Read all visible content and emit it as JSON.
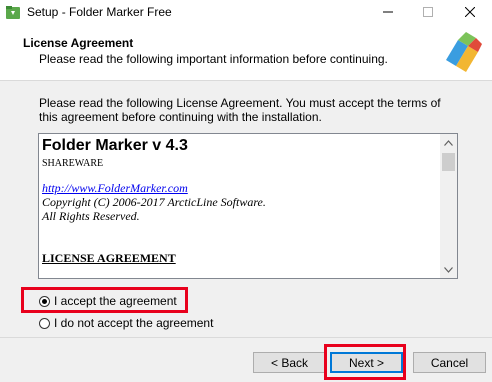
{
  "window": {
    "title": "Setup - Folder Marker Free",
    "minimize_glyph": "—",
    "maximize_glyph": "☐",
    "close_glyph": "✕"
  },
  "header": {
    "title": "License Agreement",
    "subtitle": "Please read the following important information before continuing."
  },
  "main": {
    "intro": "Please read the following License Agreement. You must accept the terms of this agreement before continuing with the installation.",
    "license": {
      "title": "Folder Marker v 4.3",
      "edition": "SHAREWARE",
      "link": "http://www.FolderMarker.com",
      "copyright": "Copyright (C) 2006-2017 ArcticLine Software.",
      "rights": "All Rights Reserved.",
      "heading": "LICENSE AGREEMENT"
    },
    "options": [
      {
        "label": "I accept the agreement",
        "selected": true
      },
      {
        "label": "I do not accept the agreement",
        "selected": false
      }
    ]
  },
  "footer": {
    "back_label": "< Back",
    "next_label": "Next >",
    "cancel_label": "Cancel"
  },
  "icons": {
    "app": "folder-marker-app-icon",
    "logo": "folder-marker-logo-icon",
    "scroll_up": "chevron-up-icon",
    "scroll_down": "chevron-down-icon"
  },
  "colors": {
    "highlight": "#e8001c",
    "link": "#0000ee",
    "dialog_bg": "#f0f0f0"
  }
}
